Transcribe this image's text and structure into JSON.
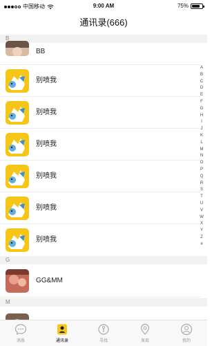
{
  "status_bar": {
    "carrier": "中国移动",
    "time": "9:00 AM",
    "battery": "75%",
    "battery_level": 0.75
  },
  "nav": {
    "title": "通讯录(666)"
  },
  "sections": [
    {
      "letter": "B"
    },
    {
      "letter": "G"
    },
    {
      "letter": "M"
    }
  ],
  "contacts": [
    {
      "name": "BB",
      "avatar_icon": "photo-avatar"
    },
    {
      "name": "别喷我",
      "avatar_icon": "cartoon-avatar"
    },
    {
      "name": "别喷我",
      "avatar_icon": "cartoon-avatar"
    },
    {
      "name": "别喷我",
      "avatar_icon": "cartoon-avatar"
    },
    {
      "name": "别喷我",
      "avatar_icon": "cartoon-avatar"
    },
    {
      "name": "别喷我",
      "avatar_icon": "cartoon-avatar"
    },
    {
      "name": "别喷我",
      "avatar_icon": "cartoon-avatar"
    },
    {
      "name": "GG&MM",
      "avatar_icon": "photo-avatar"
    }
  ],
  "index_letters": [
    "A",
    "B",
    "C",
    "D",
    "E",
    "F",
    "G",
    "H",
    "I",
    "J",
    "K",
    "L",
    "M",
    "N",
    "O",
    "P",
    "Q",
    "R",
    "S",
    "T",
    "U",
    "V",
    "W",
    "X",
    "Y",
    "Z",
    "#"
  ],
  "tabs": [
    {
      "label": "消息",
      "icon": "chat-bubble-icon",
      "active": false
    },
    {
      "label": "通讯录",
      "icon": "contacts-icon",
      "active": true
    },
    {
      "label": "寻找",
      "icon": "compass-icon",
      "active": false
    },
    {
      "label": "发现",
      "icon": "location-pin-icon",
      "active": false
    },
    {
      "label": "我的",
      "icon": "profile-icon",
      "active": false
    }
  ],
  "colors": {
    "accent": "#f5c518",
    "section_bg": "#f1f1f1"
  }
}
